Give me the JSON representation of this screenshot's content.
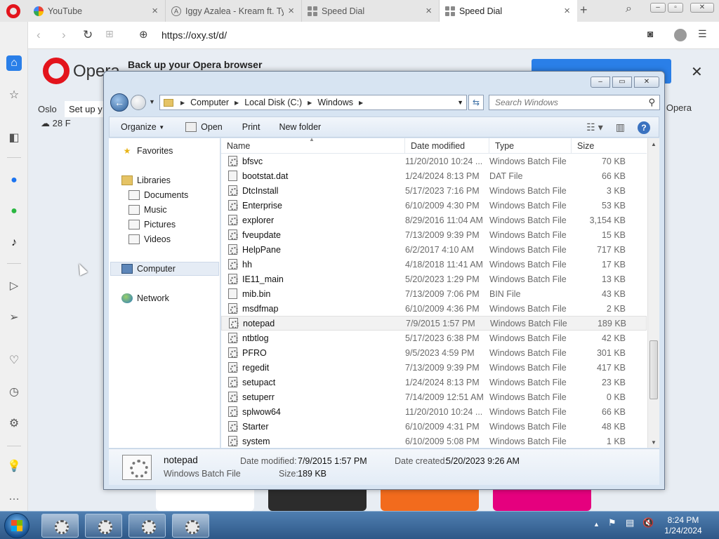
{
  "browser": {
    "tabs": [
      {
        "title": "YouTube",
        "icon": "google-icon",
        "close": "×"
      },
      {
        "title": "Iggy Azalea - Kream ft. Tyga",
        "icon": "page-icon",
        "close": "×"
      },
      {
        "title": "Speed Dial",
        "icon": "speed-dial-icon",
        "close": "×"
      },
      {
        "title": "Speed Dial",
        "icon": "speed-dial-icon",
        "close": "×"
      }
    ],
    "url": "https://oxy.st/d/",
    "banner": {
      "logo_text": "Opera",
      "title": "Back up your Opera browser"
    },
    "location": "Oslo",
    "setup_text": "Set up y",
    "weather": "28 F",
    "right_text": "n Opera",
    "tile_colors": [
      "#ffffff",
      "#2c2c2c",
      "#f26b1d",
      "#e5007e"
    ]
  },
  "explorer": {
    "address": [
      "Computer",
      "Local Disk (C:)",
      "Windows"
    ],
    "search_placeholder": "Search Windows",
    "toolbar": {
      "organize": "Organize",
      "open": "Open",
      "print": "Print",
      "new_folder": "New folder"
    },
    "nav": {
      "favorites": "Favorites",
      "libraries": "Libraries",
      "documents": "Documents",
      "music": "Music",
      "pictures": "Pictures",
      "videos": "Videos",
      "computer": "Computer",
      "network": "Network"
    },
    "columns": {
      "name": "Name",
      "date": "Date modified",
      "type": "Type",
      "size": "Size"
    },
    "files": [
      {
        "name": "bfsvc",
        "date": "11/20/2010 10:24 ...",
        "type": "Windows Batch File",
        "size": "70 KB",
        "icon": "bat"
      },
      {
        "name": "bootstat.dat",
        "date": "1/24/2024 8:13 PM",
        "type": "DAT File",
        "size": "66 KB",
        "icon": "file"
      },
      {
        "name": "DtcInstall",
        "date": "5/17/2023 7:16 PM",
        "type": "Windows Batch File",
        "size": "3 KB",
        "icon": "bat"
      },
      {
        "name": "Enterprise",
        "date": "6/10/2009 4:30 PM",
        "type": "Windows Batch File",
        "size": "53 KB",
        "icon": "bat"
      },
      {
        "name": "explorer",
        "date": "8/29/2016 11:04 AM",
        "type": "Windows Batch File",
        "size": "3,154 KB",
        "icon": "bat"
      },
      {
        "name": "fveupdate",
        "date": "7/13/2009 9:39 PM",
        "type": "Windows Batch File",
        "size": "15 KB",
        "icon": "bat"
      },
      {
        "name": "HelpPane",
        "date": "6/2/2017 4:10 AM",
        "type": "Windows Batch File",
        "size": "717 KB",
        "icon": "bat"
      },
      {
        "name": "hh",
        "date": "4/18/2018 11:41 AM",
        "type": "Windows Batch File",
        "size": "17 KB",
        "icon": "bat"
      },
      {
        "name": "IE11_main",
        "date": "5/20/2023 1:29 PM",
        "type": "Windows Batch File",
        "size": "13 KB",
        "icon": "bat"
      },
      {
        "name": "mib.bin",
        "date": "7/13/2009 7:06 PM",
        "type": "BIN File",
        "size": "43 KB",
        "icon": "file"
      },
      {
        "name": "msdfmap",
        "date": "6/10/2009 4:36 PM",
        "type": "Windows Batch File",
        "size": "2 KB",
        "icon": "bat"
      },
      {
        "name": "notepad",
        "date": "7/9/2015 1:57 PM",
        "type": "Windows Batch File",
        "size": "189 KB",
        "icon": "bat",
        "highlight": true
      },
      {
        "name": "ntbtlog",
        "date": "5/17/2023 6:38 PM",
        "type": "Windows Batch File",
        "size": "42 KB",
        "icon": "bat"
      },
      {
        "name": "PFRO",
        "date": "9/5/2023 4:59 PM",
        "type": "Windows Batch File",
        "size": "301 KB",
        "icon": "bat"
      },
      {
        "name": "regedit",
        "date": "7/13/2009 9:39 PM",
        "type": "Windows Batch File",
        "size": "417 KB",
        "icon": "bat"
      },
      {
        "name": "setupact",
        "date": "1/24/2024 8:13 PM",
        "type": "Windows Batch File",
        "size": "23 KB",
        "icon": "bat"
      },
      {
        "name": "setuperr",
        "date": "7/14/2009 12:51 AM",
        "type": "Windows Batch File",
        "size": "0 KB",
        "icon": "bat"
      },
      {
        "name": "splwow64",
        "date": "11/20/2010 10:24 ...",
        "type": "Windows Batch File",
        "size": "66 KB",
        "icon": "bat"
      },
      {
        "name": "Starter",
        "date": "6/10/2009 4:31 PM",
        "type": "Windows Batch File",
        "size": "48 KB",
        "icon": "bat"
      },
      {
        "name": "system",
        "date": "6/10/2009 5:08 PM",
        "type": "Windows Batch File",
        "size": "1 KB",
        "icon": "bat"
      }
    ],
    "details": {
      "name": "notepad",
      "type": "Windows Batch File",
      "modified_label": "Date modified:",
      "modified": "7/9/2015 1:57 PM",
      "created_label": "Date created:",
      "created": "5/20/2023 9:26 AM",
      "size_label": "Size:",
      "size": "189 KB"
    }
  },
  "taskbar": {
    "time": "8:24 PM",
    "date": "1/24/2024"
  }
}
